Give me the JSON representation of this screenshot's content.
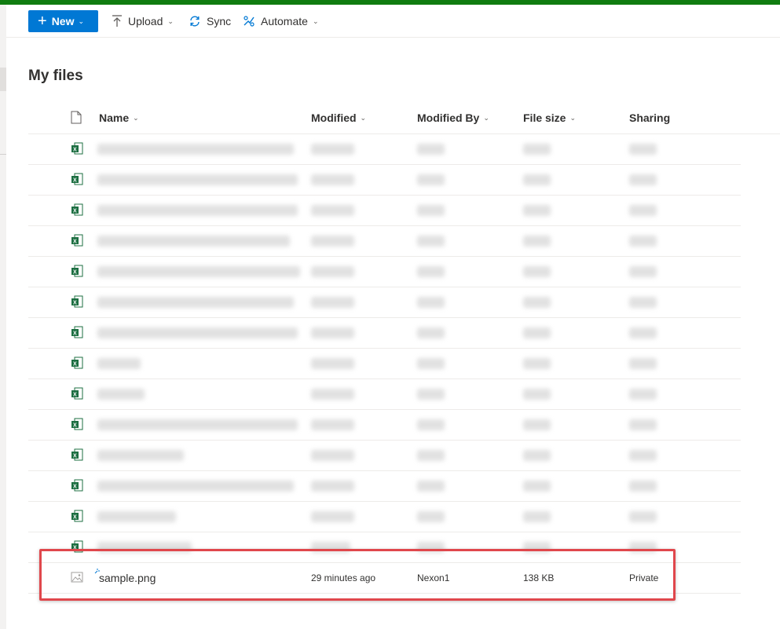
{
  "toolbar": {
    "new_label": "New",
    "upload_label": "Upload",
    "sync_label": "Sync",
    "automate_label": "Automate"
  },
  "page": {
    "title": "My files"
  },
  "columns": {
    "name": "Name",
    "modified": "Modified",
    "modified_by": "Modified By",
    "file_size": "File size",
    "sharing": "Sharing"
  },
  "icons": {
    "excel": "excel-file-icon",
    "image": "image-file-icon",
    "document_header": "document-icon"
  },
  "colors": {
    "accent": "#0078d4",
    "top_bar": "#107c10",
    "highlight_border": "#e0474c",
    "excel_green": "#1d6f42"
  },
  "highlighted_file": {
    "name": "sample.png",
    "modified": "29 minutes ago",
    "modified_by": "Nexon1",
    "file_size": "138 KB",
    "sharing": "Private"
  }
}
